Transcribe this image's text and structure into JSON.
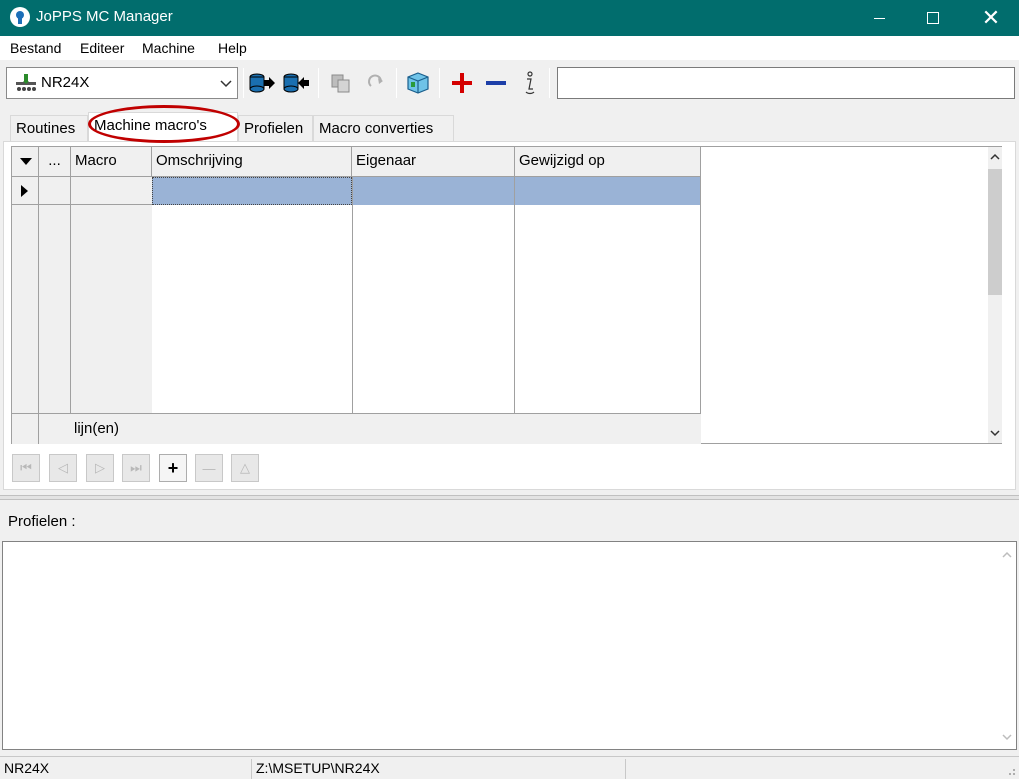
{
  "window": {
    "title": "JoPPS MC Manager",
    "close_glyph": "✕"
  },
  "menu": {
    "items": [
      "Bestand",
      "Editeer",
      "Machine",
      "Help"
    ]
  },
  "toolbar": {
    "machine_value": "NR24X",
    "search_value": ""
  },
  "tabs": {
    "items": [
      "Routines",
      "Machine macro's",
      "Profielen",
      "Macro converties"
    ],
    "active": "Machine macro's"
  },
  "grid": {
    "indicator_header": "",
    "ellipsis_header": "...",
    "columns": [
      "Macro",
      "Omschrijving",
      "Eigenaar",
      "Gewijzigd op"
    ],
    "footer_label": "lijn(en)"
  },
  "navigator": {
    "add_glyph": "+",
    "delete_glyph": "—",
    "first_glyph": "⏮",
    "prev_glyph": "◁",
    "next_glyph": "▷",
    "last_glyph": "⏭",
    "edit_glyph": "△"
  },
  "profiles": {
    "label": "Profielen :",
    "memo_value": ""
  },
  "statusbar": {
    "machine": "NR24X",
    "path": "Z:\\MSETUP\\NR24X"
  },
  "colors": {
    "titlebar": "#016d6d",
    "selection": "#9ab3d6",
    "highlight_ellipse": "#c00000",
    "add_icon": "#d40000",
    "remove_icon": "#1d3fa8"
  }
}
